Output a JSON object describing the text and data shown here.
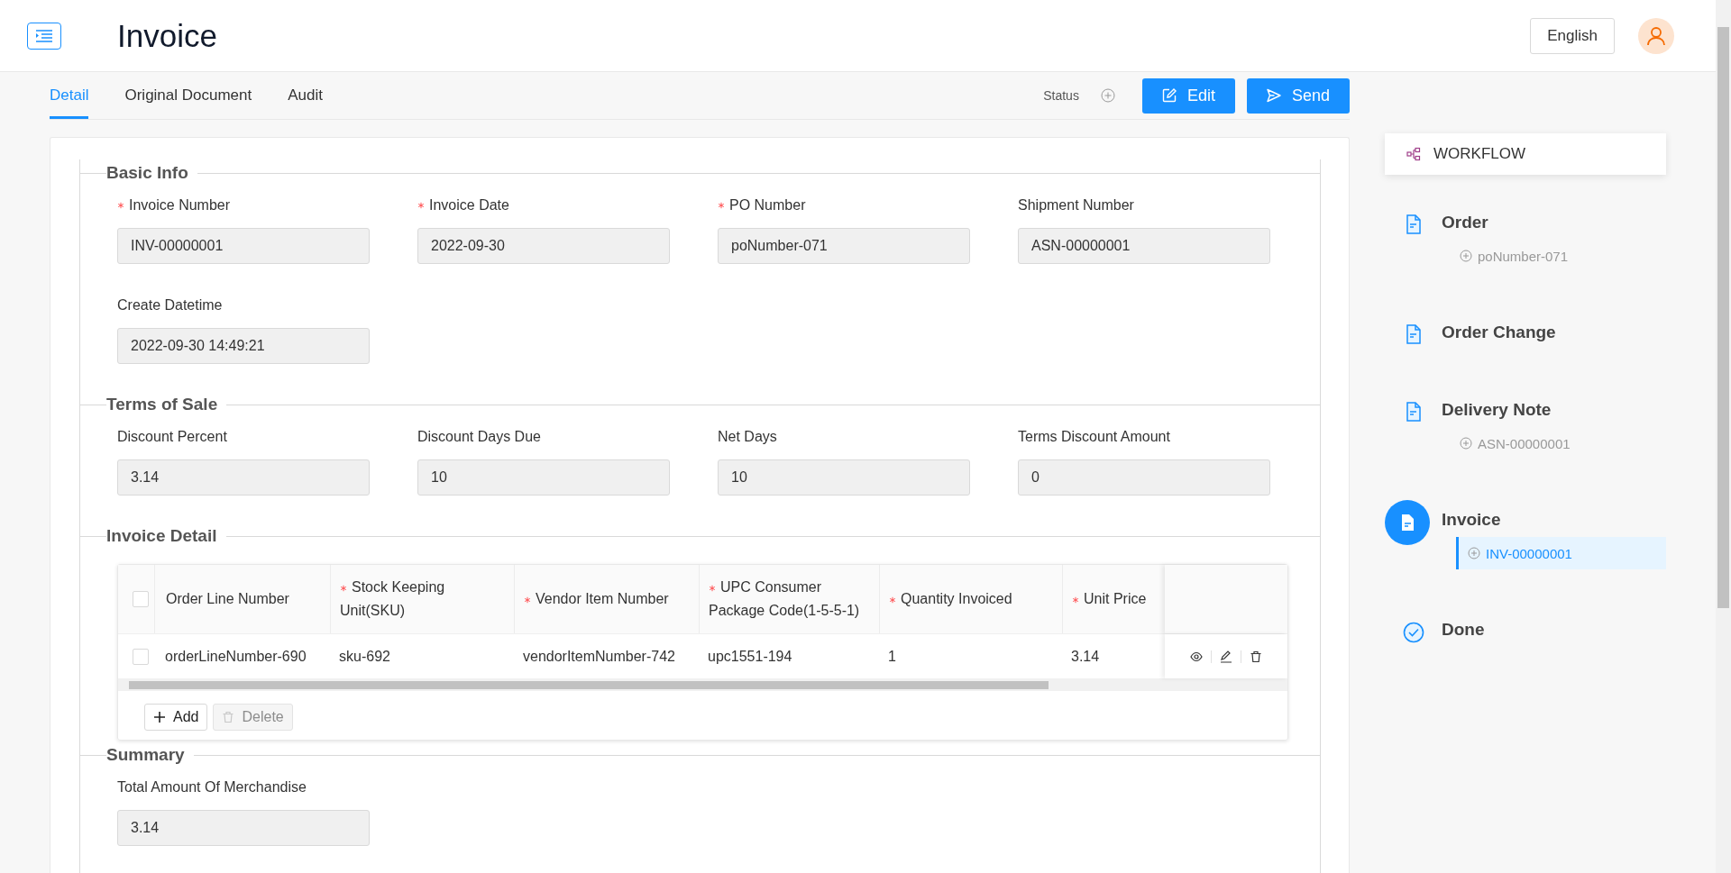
{
  "header": {
    "title": "Invoice",
    "language": "English"
  },
  "tabs": [
    {
      "label": "Detail",
      "selected": true
    },
    {
      "label": "Original Document",
      "selected": false
    },
    {
      "label": "Audit",
      "selected": false
    }
  ],
  "status": {
    "label": "Status"
  },
  "actions": [
    {
      "label": "Edit",
      "kind": "edit"
    },
    {
      "label": "Send",
      "kind": "send"
    }
  ],
  "sections": [
    {
      "title": "Basic Info",
      "kind": "fields",
      "fields": [
        {
          "label": "Invoice Number",
          "required": true,
          "value": "INV-00000001"
        },
        {
          "label": "Invoice Date",
          "required": true,
          "value": "2022-09-30"
        },
        {
          "label": "PO Number",
          "required": true,
          "value": "poNumber-071"
        },
        {
          "label": "Shipment Number",
          "required": false,
          "value": "ASN-00000001"
        },
        {
          "label": "Create Datetime",
          "required": false,
          "value": "2022-09-30 14:49:21"
        }
      ]
    },
    {
      "title": "Terms of Sale",
      "kind": "fields",
      "fields": [
        {
          "label": "Discount Percent",
          "required": false,
          "value": "3.14"
        },
        {
          "label": "Discount Days Due",
          "required": false,
          "value": "10"
        },
        {
          "label": "Net Days",
          "required": false,
          "value": "10"
        },
        {
          "label": "Terms Discount Amount",
          "required": false,
          "value": "0"
        }
      ]
    },
    {
      "title": "Invoice Detail",
      "kind": "table",
      "header_checked": false,
      "columns": [
        {
          "label": "Order Line Number",
          "required": false
        },
        {
          "label": "Stock Keeping Unit(SKU)",
          "required": true
        },
        {
          "label": "Vendor Item Number",
          "required": true
        },
        {
          "label": "UPC Consumer Package Code(1-5-5-1)",
          "required": true
        },
        {
          "label": "Quantity Invoiced",
          "required": true
        },
        {
          "label": "Unit Price",
          "required": true
        }
      ],
      "rows": [
        {
          "checked": false,
          "cells": [
            "orderLineNumber-690",
            "sku-692",
            "vendorItemNumber-742",
            "upc1551-194",
            "1",
            "3.14"
          ]
        }
      ],
      "buttons": [
        {
          "label": "Add",
          "kind": "add",
          "disabled": false
        },
        {
          "label": "Delete",
          "kind": "delete",
          "disabled": true
        }
      ]
    },
    {
      "title": "Summary",
      "kind": "fields",
      "fields": [
        {
          "label": "Total Amount Of Merchandise",
          "required": false,
          "value": "3.14"
        }
      ]
    }
  ],
  "workflow": {
    "title": "WORKFLOW",
    "steps": [
      {
        "label": "Order",
        "kind": "document",
        "current": false,
        "children": [
          {
            "label": "poNumber-071",
            "selected": false
          }
        ]
      },
      {
        "label": "Order Change",
        "kind": "document",
        "current": false
      },
      {
        "label": "Delivery Note",
        "kind": "document",
        "current": false,
        "children": [
          {
            "label": "ASN-00000001",
            "selected": false
          }
        ]
      },
      {
        "label": "Invoice",
        "kind": "document",
        "current": true,
        "children": [
          {
            "label": "INV-00000001",
            "selected": true
          }
        ]
      },
      {
        "label": "Done",
        "kind": "done",
        "current": false
      }
    ]
  }
}
